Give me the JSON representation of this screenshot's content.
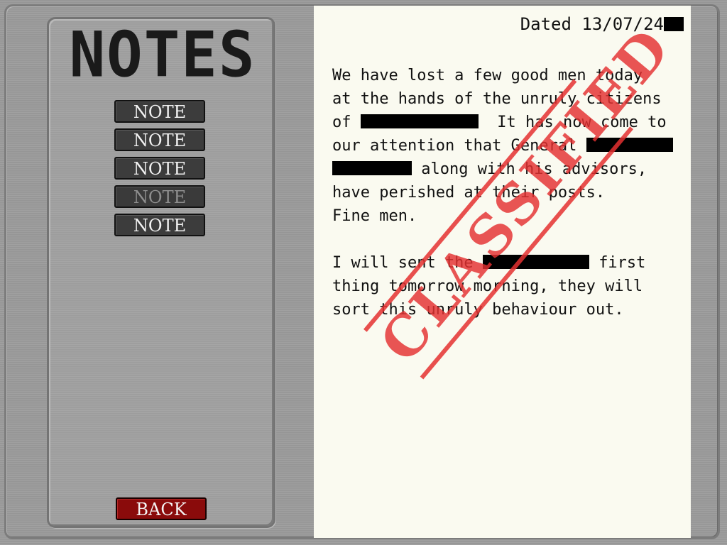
{
  "left_panel": {
    "title": "NOTES",
    "notes": [
      {
        "label": "NOTE",
        "active": false
      },
      {
        "label": "NOTE",
        "active": false
      },
      {
        "label": "NOTE",
        "active": false
      },
      {
        "label": "NOTE",
        "active": true
      },
      {
        "label": "NOTE",
        "active": false
      }
    ],
    "back_label": "BACK"
  },
  "document": {
    "date_text": "Dated 13/07/24",
    "lines": [
      "We have lost a few good men today",
      "at the hands of the unruly citizens",
      "of",
      "It has now come to",
      "our attention that General",
      "along with his advisors,",
      "have perished at their posts.",
      "Fine men.",
      "I will sent the",
      "first",
      "thing tomorrow morning, they will",
      "sort this unruly behaviour out."
    ],
    "stamp_text": "CLASSIFIED"
  },
  "colors": {
    "stamp": "#e43030",
    "back_button": "#8a0b0b",
    "paper": "#fafaf0"
  }
}
